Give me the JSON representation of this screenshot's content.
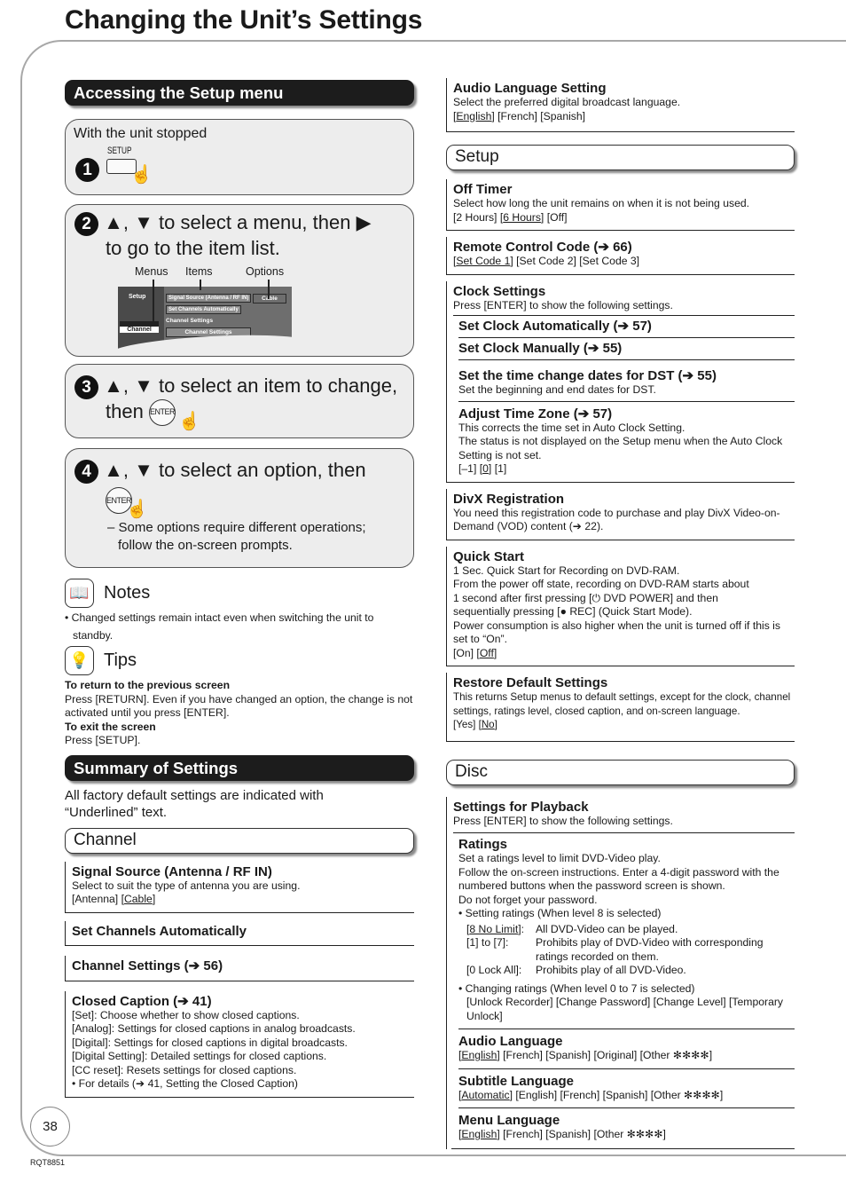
{
  "page": {
    "title": "Changing the Unit’s Settings",
    "page_number": "38",
    "doc_code": "RQT8851"
  },
  "accessing": {
    "heading": "Accessing the Setup menu",
    "step1": {
      "number": "1",
      "intro": "With the unit stopped",
      "button_label": "SETUP"
    },
    "step2": {
      "number": "2",
      "text_line1": "▲, ▼ to select a menu, then ▶",
      "text_line2": "to go to the item list.",
      "diagram": {
        "label_menus": "Menus",
        "label_items": "Items",
        "label_options": "Options",
        "menu_setup": "Setup",
        "menu_channel": "Channel",
        "menu_setup2": "Setup",
        "item_signal": "Signal Source (Antenna / RF IN)",
        "item_auto": "Set Channels Automatically",
        "item_header": "Channel Settings",
        "item_channel_settings": "Channel Settings",
        "option_cable": "Cable"
      }
    },
    "step3": {
      "number": "3",
      "text_line1": "▲, ▼ to select an item to change,",
      "text_line2": "then",
      "button_label": "ENTER"
    },
    "step4": {
      "number": "4",
      "text_line1": "▲, ▼ to select an option, then",
      "button_label": "ENTER",
      "note_line1": "– Some options require different operations;",
      "note_line2": "follow the on-screen prompts."
    }
  },
  "notes": {
    "heading": "Notes",
    "bullet": "Changed settings remain intact even when switching the unit to",
    "bullet_cont": "standby."
  },
  "tips": {
    "heading": "Tips",
    "return_title": "To return to the previous screen",
    "return_text": "Press [RETURN]. Even if you have changed an option, the change is not activated until you press [ENTER].",
    "exit_title": "To exit the screen",
    "exit_text": "Press [SETUP]."
  },
  "summary": {
    "heading": "Summary of Settings",
    "intro_line1": "All factory default settings are indicated with",
    "intro_line2": "“Underlined” text."
  },
  "channel": {
    "heading": "Channel",
    "signal_title": "Signal Source (Antenna / RF IN)",
    "signal_desc": "Select to suit the type of antenna you are using.",
    "signal_opt1": "[Antenna]",
    "signal_opt2": "Cable",
    "auto_title": "Set Channels Automatically",
    "settings_title": "Channel Settings (➔ 56)",
    "cc_title": "Closed Caption (➔ 41)",
    "cc_lines": [
      "[Set]: Choose whether to show closed captions.",
      "[Analog]: Settings for closed captions in analog broadcasts.",
      "[Digital]: Settings for closed captions in digital broadcasts.",
      "[Digital Setting]: Detailed settings for closed captions.",
      "[CC reset]:  Resets settings for closed captions.",
      "• For details (➔ 41, Setting the Closed Caption)"
    ]
  },
  "audio_setting": {
    "title": "Audio Language Setting",
    "desc": "Select the preferred digital broadcast language.",
    "opt_default": "English",
    "opt_rest": "[French] [Spanish]"
  },
  "setup": {
    "heading": "Setup",
    "off_timer_title": "Off Timer",
    "off_timer_desc": "Select how long the unit remains on when it is not being used.",
    "off_timer_opt1": "[2 Hours]",
    "off_timer_default": "6 Hours",
    "off_timer_opt3": "[Off]",
    "remote_title": "Remote Control Code (➔ 66)",
    "remote_default": "Set Code 1",
    "remote_rest": "[Set Code 2] [Set Code 3]",
    "clock_title": "Clock Settings",
    "clock_desc": "Press [ENTER] to show the following settings.",
    "clock_auto": "Set Clock Automatically (➔ 57)",
    "clock_manual": "Set Clock Manually (➔ 55)",
    "dst_title": "Set the time change dates for DST (➔ 55)",
    "dst_desc": "Set the beginning and end dates for DST.",
    "tz_title": "Adjust Time Zone (➔ 57)",
    "tz_desc1": "This corrects the time set in Auto Clock Setting.",
    "tz_desc2": "The status is not displayed on the Setup menu when the Auto Clock Setting is not set.",
    "tz_opt1": "[–1]",
    "tz_default": "0",
    "tz_opt3": "[1]",
    "divx_title": "DivX Registration",
    "divx_desc": "You need this registration code to purchase and play DivX Video-on-Demand (VOD) content (➔ 22).",
    "quick_title": "Quick Start",
    "quick_lines": [
      "1 Sec. Quick Start for Recording on DVD-RAM.",
      "From the power off state, recording on DVD-RAM starts about",
      "1 second after first pressing [⏻ DVD POWER] and then",
      "sequentially pressing [● REC] (Quick Start Mode).",
      "Power consumption is also higher when the unit is turned off if this is set to “On”."
    ],
    "quick_opt1": "[On]",
    "quick_default": "Off",
    "restore_title": "Restore Default Settings",
    "restore_desc": "This returns Setup menus to default settings, except for the clock, channel settings, ratings level, closed caption, and on-screen language.",
    "restore_opt1": "[Yes]",
    "restore_default": "No"
  },
  "disc": {
    "heading": "Disc",
    "playback_title": "Settings for Playback",
    "playback_desc": "Press [ENTER] to show the following settings.",
    "ratings_title": "Ratings",
    "ratings_lines": [
      "Set a ratings level to limit DVD-Video play.",
      "Follow the on-screen instructions. Enter a 4-digit password with the numbered buttons when the password screen is shown.",
      "Do not forget your password."
    ],
    "ratings_bullet1": "• Setting ratings (When level 8 is selected)",
    "ratings_table": [
      {
        "key": "8 No Limit",
        "value": "All DVD-Video can be played."
      },
      {
        "key": "[1] to [7]:",
        "value": "Prohibits play of DVD-Video with corresponding ratings recorded on them."
      },
      {
        "key": "[0 Lock All]:",
        "value": "Prohibits play of all DVD-Video."
      }
    ],
    "ratings_bullet2": "• Changing ratings (When level 0 to 7 is selected)",
    "ratings_bullet2_opts": "[Unlock Recorder] [Change Password] [Change Level] [Temporary Unlock]",
    "audio_title": "Audio Language",
    "audio_default": "English",
    "audio_rest": "[French] [Spanish] [Original] [Other ✻✻✻✻]",
    "subtitle_title": "Subtitle Language",
    "subtitle_default": "Automatic",
    "subtitle_rest": "[English] [French] [Spanish] [Other ✻✻✻✻]",
    "menu_title": "Menu Language",
    "menu_default": "English",
    "menu_rest": "[French] [Spanish] [Other ✻✻✻✻]"
  }
}
